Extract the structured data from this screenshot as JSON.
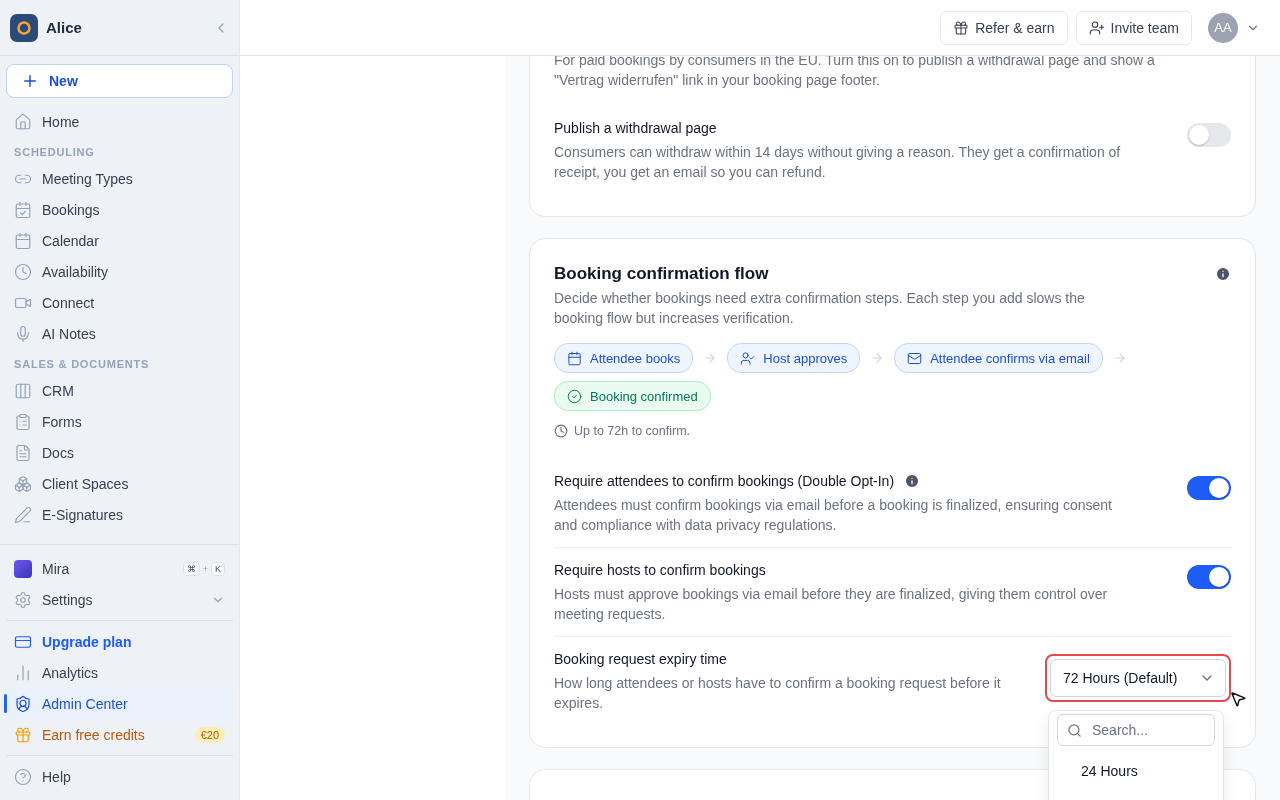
{
  "sidebar": {
    "workspace": "Alice",
    "new_button": "New",
    "top_items": [
      {
        "label": "Home"
      }
    ],
    "sections": [
      {
        "title": "SCHEDULING",
        "items": [
          {
            "label": "Meeting Types"
          },
          {
            "label": "Bookings"
          },
          {
            "label": "Calendar"
          },
          {
            "label": "Availability"
          },
          {
            "label": "Connect"
          },
          {
            "label": "AI Notes"
          }
        ]
      },
      {
        "title": "SALES & DOCUMENTS",
        "items": [
          {
            "label": "CRM"
          },
          {
            "label": "Forms"
          },
          {
            "label": "Docs"
          },
          {
            "label": "Client Spaces"
          },
          {
            "label": "E-Signatures"
          }
        ]
      }
    ],
    "assistant": {
      "label": "Mira",
      "shortcut": [
        "⌘",
        "+",
        "K"
      ]
    },
    "settings": {
      "label": "Settings",
      "expanded": false
    },
    "bottom_items": [
      {
        "label": "Upgrade plan",
        "kind": "upgrade",
        "selected": false
      },
      {
        "label": "Analytics",
        "kind": "analytics",
        "selected": false
      },
      {
        "label": "Admin Center",
        "kind": "admin",
        "selected": true
      },
      {
        "label": "Earn free credits",
        "kind": "credits",
        "selected": false,
        "badge": "€20"
      }
    ],
    "help": "Help"
  },
  "header": {
    "buttons": [
      {
        "label": "Refer & earn"
      },
      {
        "label": "Invite team"
      }
    ],
    "avatar": "AA"
  },
  "cards": [
    {
      "description": "For paid bookings by consumers in the EU. Turn this on to publish a withdrawal page and show a \"Vertrag widerrufen\" link in your booking page footer.",
      "settings": [
        {
          "kind": "toggle",
          "title": "Publish a withdrawal page",
          "description": "Consumers can withdraw within 14 days without giving a reason. They get a confirmation of receipt, you get an email so you can refund.",
          "on": false
        }
      ]
    },
    {
      "title": "Booking confirmation flow",
      "info": true,
      "description": "Decide whether bookings need extra confirmation steps. Each step you add slows the booking flow but increases verification.",
      "flow": [
        {
          "label": "Attendee books",
          "kind": "step"
        },
        {
          "label": "Host approves",
          "kind": "step"
        },
        {
          "label": "Attendee confirms via email",
          "kind": "step"
        },
        {
          "label": "Booking confirmed",
          "kind": "done"
        }
      ],
      "note": "Up to 72h to confirm.",
      "settings": [
        {
          "kind": "toggle",
          "title": "Require attendees to confirm bookings (Double Opt-In)",
          "info": true,
          "description": "Attendees must confirm bookings via email before a booking is finalized, ensuring consent and compliance with data privacy regulations.",
          "on": true
        },
        {
          "kind": "toggle",
          "title": "Require hosts to confirm bookings",
          "description": "Hosts must approve bookings via email before they are finalized, giving them control over meeting requests.",
          "on": true
        },
        {
          "kind": "select",
          "title": "Booking request expiry time",
          "description": "How long attendees or hosts have to confirm a booking request before it expires.",
          "value": "72 Hours (Default)",
          "expanded": true,
          "dropdown": {
            "placeholder": "Search...",
            "options": [
              {
                "label": "24 Hours",
                "selected": false
              }
            ]
          }
        }
      ]
    }
  ]
}
